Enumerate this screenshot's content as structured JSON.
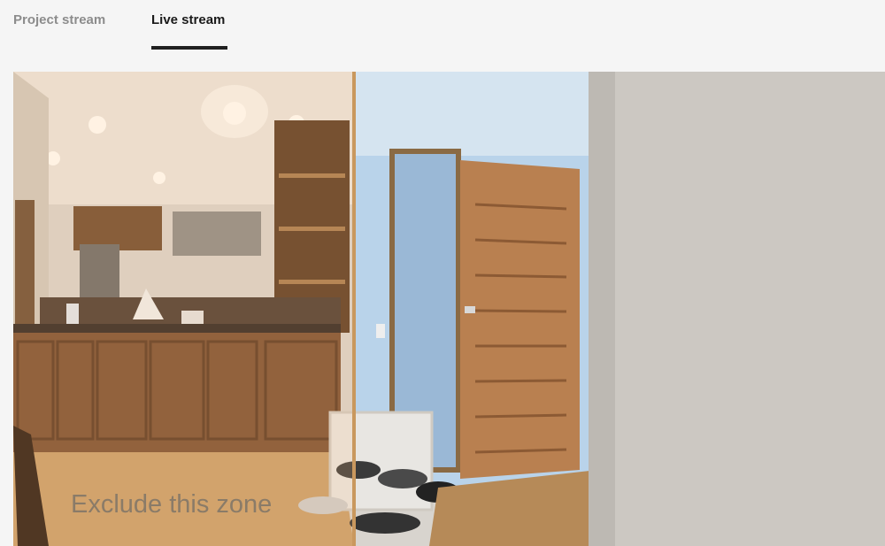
{
  "tabs": [
    {
      "label": "Project stream",
      "active": false
    },
    {
      "label": "Live stream",
      "active": true
    }
  ],
  "stream": {
    "zone_label": "Exclude this zone"
  },
  "colors": {
    "active_tab": "#1a1a1a",
    "inactive_tab": "#8c8c8c",
    "zone_divider": "#c9985e"
  }
}
